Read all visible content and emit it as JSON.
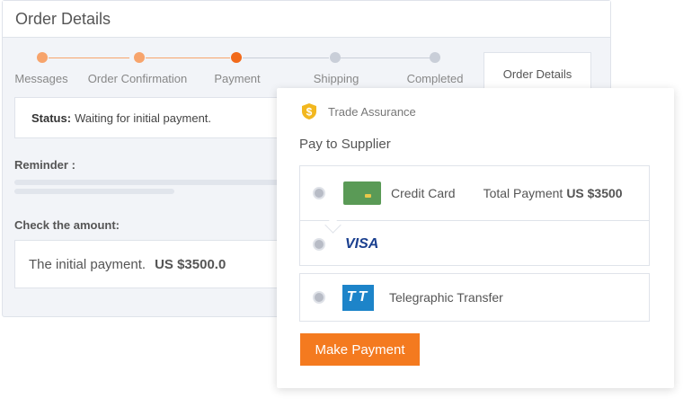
{
  "order": {
    "title": "Order Details",
    "steps": [
      {
        "label": "Messages",
        "state": "done"
      },
      {
        "label": "Order Confirmation",
        "state": "done"
      },
      {
        "label": "Payment",
        "state": "current"
      },
      {
        "label": "Shipping",
        "state": "pending"
      },
      {
        "label": "Completed",
        "state": "pending"
      }
    ],
    "details_tab": "Order Details",
    "status_label": "Status:",
    "status_value": "Waiting for initial payment.",
    "reminder_label": "Reminder :",
    "check_label": "Check the amount:",
    "amount_text": "The initial payment.",
    "amount_value": "US $3500.0"
  },
  "payment": {
    "trade_assurance": "Trade Assurance",
    "title": "Pay to Supplier",
    "credit_card_label": "Credit Card",
    "total_label": "Total Payment",
    "total_value": "US $3500",
    "visa_label": "VISA",
    "tt_icon_text": "TT",
    "tt_label": "Telegraphic Transfer",
    "button_label": "Make Payment"
  },
  "colors": {
    "accent": "#f47a1f",
    "step_done": "#f7a46c",
    "step_current": "#f26a1b",
    "step_pending": "#c9ced8",
    "card_green": "#5a9a56",
    "tt_blue": "#1d84c9",
    "visa_blue": "#1a3f8f",
    "shield_gold": "#f2b71f"
  },
  "icons": {
    "trade_assurance": "dollar-shield-icon",
    "credit_card": "credit-card-icon",
    "tt": "tt-transfer-icon"
  }
}
